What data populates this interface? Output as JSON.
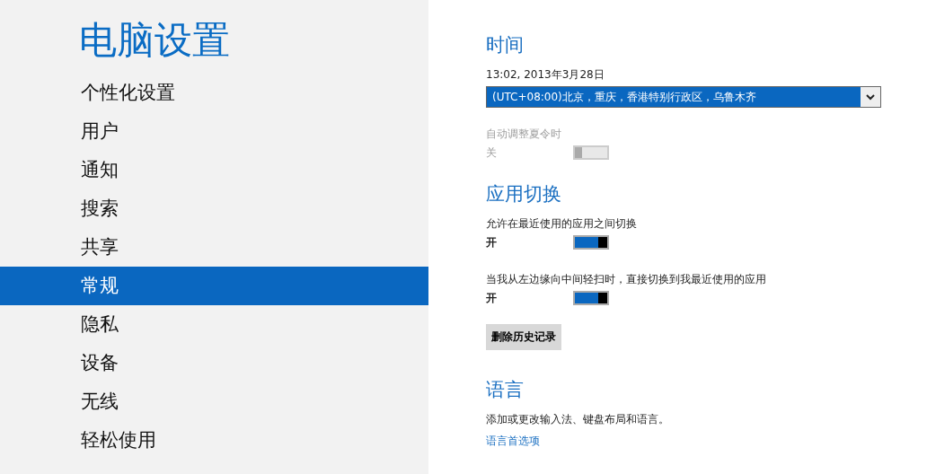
{
  "sidebar": {
    "title": "电脑设置",
    "items": [
      {
        "label": "个性化设置",
        "selected": false
      },
      {
        "label": "用户",
        "selected": false
      },
      {
        "label": "通知",
        "selected": false
      },
      {
        "label": "搜索",
        "selected": false
      },
      {
        "label": "共享",
        "selected": false
      },
      {
        "label": "常规",
        "selected": true
      },
      {
        "label": "隐私",
        "selected": false
      },
      {
        "label": "设备",
        "selected": false
      },
      {
        "label": "无线",
        "selected": false
      },
      {
        "label": "轻松使用",
        "selected": false
      }
    ]
  },
  "sections": [
    {
      "title": "时间",
      "items": [
        {
          "kind": "text",
          "text": "13:02, 2013年3月28日"
        },
        {
          "kind": "select",
          "value": "(UTC+08:00)北京，重庆，香港特别行政区，乌鲁木齐"
        },
        {
          "kind": "toggle",
          "label": "自动调整夏令时",
          "state_label": "关",
          "on": false,
          "disabled": true
        }
      ]
    },
    {
      "title": "应用切换",
      "items": [
        {
          "kind": "toggle",
          "label": "允许在最近使用的应用之间切换",
          "state_label": "开",
          "on": true,
          "disabled": false
        },
        {
          "kind": "toggle",
          "label": "当我从左边缘向中间轻扫时，直接切换到我最近使用的应用",
          "state_label": "开",
          "on": true,
          "disabled": false
        },
        {
          "kind": "button",
          "label": "删除历史记录"
        }
      ]
    },
    {
      "title": "语言",
      "items": [
        {
          "kind": "text",
          "text": "添加或更改输入法、键盘布局和语言。"
        },
        {
          "kind": "link",
          "label": "语言首选项"
        }
      ]
    }
  ]
}
